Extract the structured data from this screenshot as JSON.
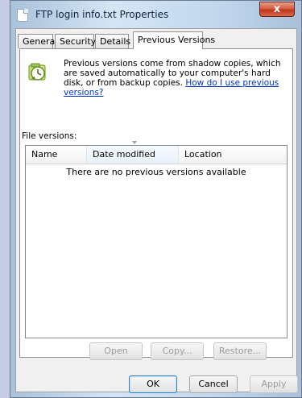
{
  "window": {
    "title": "FTP login info.txt Properties",
    "close_label": "x"
  },
  "tabs": [
    {
      "label": "General",
      "active": false
    },
    {
      "label": "Security",
      "active": false
    },
    {
      "label": "Details",
      "active": false
    },
    {
      "label": "Previous Versions",
      "active": true
    }
  ],
  "previous_versions": {
    "info_text": "Previous versions come from shadow copies, which are saved automatically to your computer's hard disk, or from backup copies.",
    "info_link": "How do I use previous versions?",
    "file_versions_label": "File versions:",
    "table": {
      "columns": [
        "Name",
        "Date modified",
        "Location"
      ],
      "empty_message": "There are no previous versions available"
    },
    "actions": {
      "open": "Open",
      "copy": "Copy...",
      "restore": "Restore..."
    }
  },
  "dialog_buttons": {
    "ok": "OK",
    "cancel": "Cancel",
    "apply": "Apply"
  },
  "colors": {
    "link": "#0033cc",
    "close_button": "#c2351a"
  }
}
